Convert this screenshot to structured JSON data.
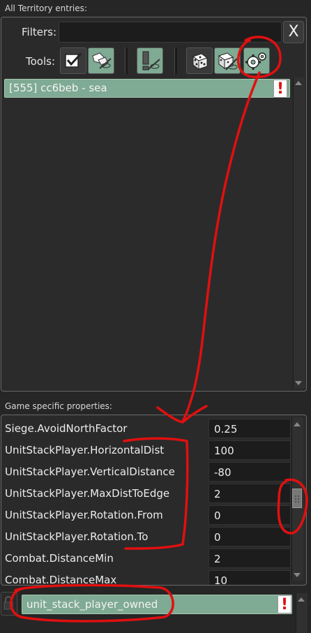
{
  "territory_section": {
    "title": "All Territory entries:",
    "filters_label": "Filters:",
    "filter_value": "",
    "clear_button": "X",
    "tools_label": "Tools:",
    "tools": [
      {
        "icon": "checklist-icon"
      },
      {
        "icon": "hide-shapes-icon"
      },
      {
        "icon": "hide-warnings-icon"
      },
      {
        "icon": "dice-icon"
      },
      {
        "icon": "dice-hidden-icon"
      },
      {
        "icon": "gears-icon"
      }
    ],
    "entries": [
      {
        "label": "[555] cc6beb - sea",
        "warning": "!"
      }
    ]
  },
  "properties_section": {
    "title": "Game specific properties:",
    "rows": [
      {
        "name": "Siege.AvoidNorthFactor",
        "value": "0.25"
      },
      {
        "name": "UnitStackPlayer.HorizontalDist",
        "value": "100"
      },
      {
        "name": "UnitStackPlayer.VerticalDistance",
        "value": "-80"
      },
      {
        "name": "UnitStackPlayer.MaxDistToEdge",
        "value": "2"
      },
      {
        "name": "UnitStackPlayer.Rotation.From",
        "value": "0"
      },
      {
        "name": "UnitStackPlayer.Rotation.To",
        "value": "0"
      },
      {
        "name": "Combat.DistanceMin",
        "value": "2"
      },
      {
        "name": "Combat.DistanceMax",
        "value": "10"
      }
    ]
  },
  "bottom_entry": {
    "label": "unit_stack_player_owned",
    "warning": "!"
  },
  "colors": {
    "accent_green": "#7faa93",
    "annotation_red": "#e01010"
  }
}
